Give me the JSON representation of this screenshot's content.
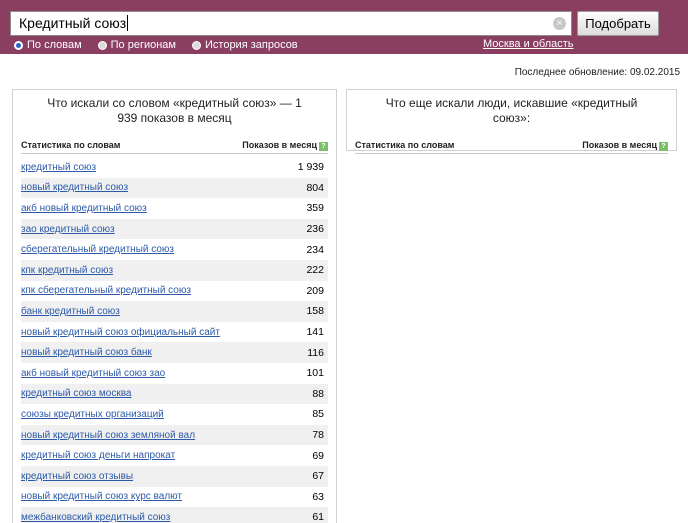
{
  "search": {
    "value": "Кредитный союз",
    "submit_label": "Подобрать"
  },
  "modes": [
    {
      "label": "По словам",
      "selected": true
    },
    {
      "label": "По регионам",
      "selected": false
    },
    {
      "label": "История запросов",
      "selected": false
    }
  ],
  "region_label": "Москва и область",
  "update_text": "Последнее обновление: 09.02.2015",
  "left_panel": {
    "title": "Что искали со словом «кредитный союз» — 1 939 показов в месяц",
    "col_words": "Статистика по словам",
    "col_views": "Показов в месяц",
    "rows": [
      {
        "phrase": "кредитный союз",
        "count": "1 939"
      },
      {
        "phrase": "новый кредитный союз",
        "count": "804"
      },
      {
        "phrase": "акб новый кредитный союз",
        "count": "359"
      },
      {
        "phrase": "зао кредитный союз",
        "count": "236"
      },
      {
        "phrase": "сберегательный кредитный союз",
        "count": "234"
      },
      {
        "phrase": "кпк кредитный союз",
        "count": "222"
      },
      {
        "phrase": "кпк сберегательный кредитный союз",
        "count": "209"
      },
      {
        "phrase": "банк кредитный союз",
        "count": "158"
      },
      {
        "phrase": "новый кредитный союз официальный сайт",
        "count": "141"
      },
      {
        "phrase": "новый кредитный союз банк",
        "count": "116"
      },
      {
        "phrase": "акб новый кредитный союз зао",
        "count": "101"
      },
      {
        "phrase": "кредитный союз москва",
        "count": "88"
      },
      {
        "phrase": "союзы кредитных организаций",
        "count": "85"
      },
      {
        "phrase": "новый кредитный союз земляной вал",
        "count": "78"
      },
      {
        "phrase": "кредитный союз деньги напрокат",
        "count": "69"
      },
      {
        "phrase": "кредитный союз отзывы",
        "count": "67"
      },
      {
        "phrase": "новый кредитный союз курс валют",
        "count": "63"
      },
      {
        "phrase": "межбанковский кредитный союз",
        "count": "61"
      }
    ]
  },
  "right_panel": {
    "title": "Что еще искали люди, искавшие «кредитный союз»:",
    "col_words": "Статистика по словам",
    "col_views": "Показов в месяц"
  },
  "icons": {
    "help": "?",
    "clear": "×"
  },
  "colors": {
    "topbar": "#8a3e60",
    "link": "#2c5aa8",
    "radio_selected": "#2a64c8",
    "help_icon": "#7bbf6a"
  }
}
